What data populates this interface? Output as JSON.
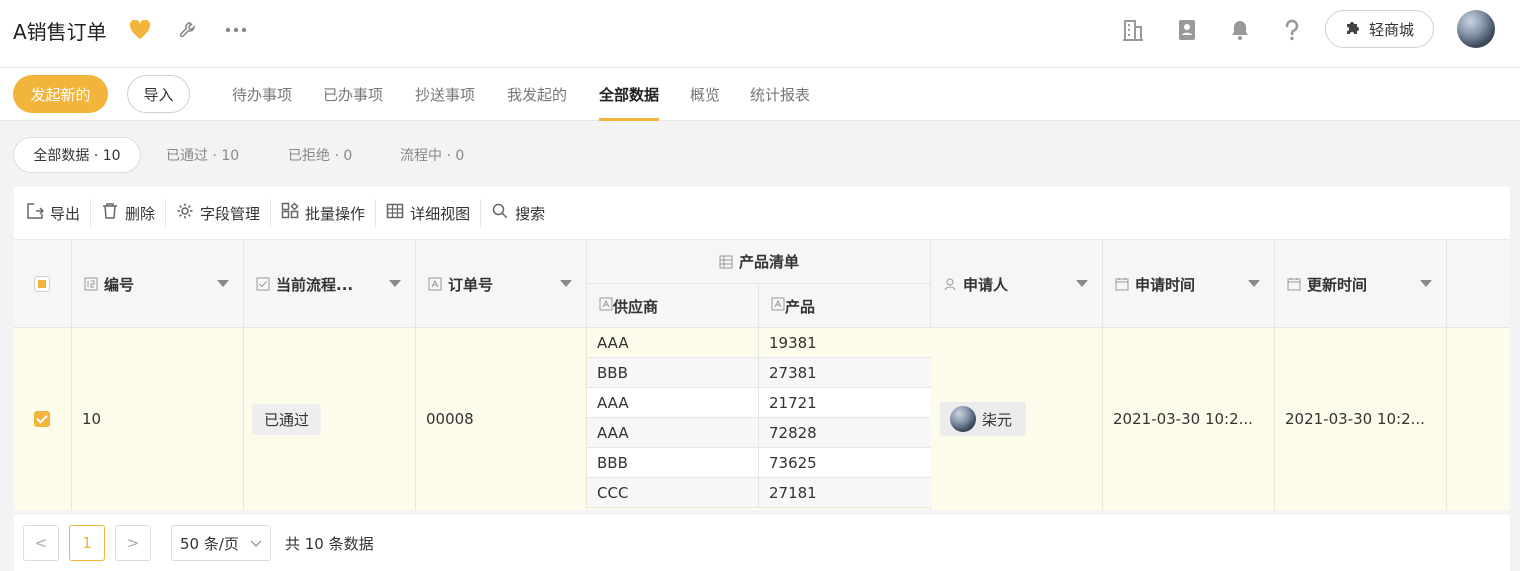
{
  "header": {
    "title": "A销售订单",
    "shop_label": "轻商城",
    "icons": [
      "heart-icon",
      "wrench-icon",
      "more-icon",
      "building-icon",
      "contacts-icon",
      "bell-icon",
      "help-icon",
      "puzzle-icon"
    ],
    "accent_color": "#f2b43a"
  },
  "tabbar": {
    "new_label": "发起新的",
    "import_label": "导入",
    "tabs": [
      {
        "label": "待办事项"
      },
      {
        "label": "已办事项"
      },
      {
        "label": "抄送事项"
      },
      {
        "label": "我发起的"
      },
      {
        "label": "全部数据",
        "active": true
      },
      {
        "label": "概览"
      },
      {
        "label": "统计报表"
      }
    ]
  },
  "filters": [
    {
      "label": "全部数据 · 10",
      "active": true
    },
    {
      "label": "已通过 · 10"
    },
    {
      "label": "已拒绝 · 0"
    },
    {
      "label": "流程中 · 0"
    }
  ],
  "toolbar": {
    "export": "导出",
    "delete": "删除",
    "fields": "字段管理",
    "batch": "批量操作",
    "detail_view": "详细视图",
    "search": "搜索"
  },
  "table": {
    "columns": {
      "id": "编号",
      "flow": "当前流程...",
      "order_no": "订单号",
      "product_group": "产品清单",
      "supplier": "供应商",
      "product": "产品",
      "applicant": "申请人",
      "apply_time": "申请时间",
      "update_time": "更新时间"
    },
    "row": {
      "checked": true,
      "id": "10",
      "status": "已通过",
      "order_no": "00008",
      "items": [
        {
          "supplier": "AAA",
          "product": "19381"
        },
        {
          "supplier": "BBB",
          "product": "27381"
        },
        {
          "supplier": "AAA",
          "product": "21721"
        },
        {
          "supplier": "AAA",
          "product": "72828"
        },
        {
          "supplier": "BBB",
          "product": "73625"
        },
        {
          "supplier": "CCC",
          "product": "27181"
        }
      ],
      "applicant": "柒元",
      "apply_time": "2021-03-30 10:2...",
      "update_time": "2021-03-30 10:2..."
    }
  },
  "pagination": {
    "prev": "<",
    "current": "1",
    "next": ">",
    "page_size": "50 条/页",
    "total": "共 10 条数据"
  }
}
